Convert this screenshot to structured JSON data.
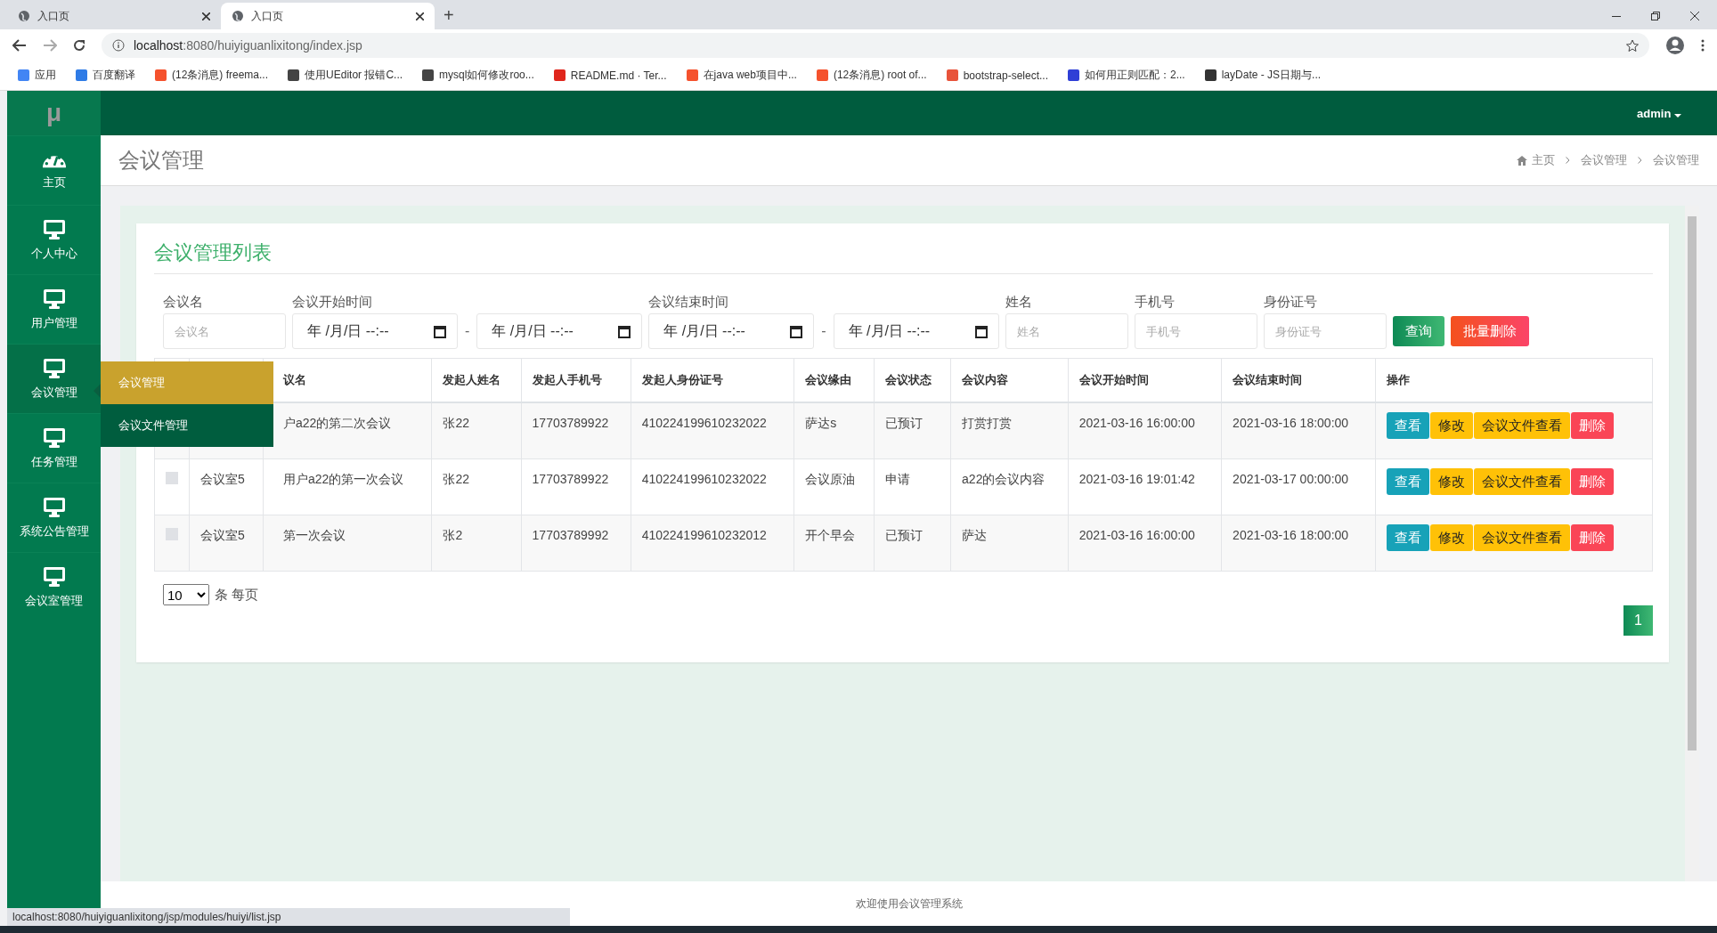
{
  "browser": {
    "tabs": [
      {
        "title": "入口页",
        "selected": false
      },
      {
        "title": "入口页",
        "selected": true
      }
    ],
    "new_tab": "+",
    "url_host": "localhost",
    "url_rest": ":8080/huiyiguanlixitong/index.jsp",
    "bookmarks": [
      {
        "label": "应用",
        "color": "#4285f4"
      },
      {
        "label": "百度翻译",
        "color": "#2e7be6"
      },
      {
        "label": "(12条消息) freema...",
        "color": "#f5522d"
      },
      {
        "label": "使用UEditor 报错C...",
        "color": "#444444"
      },
      {
        "label": "mysql如何修改roo...",
        "color": "#444444"
      },
      {
        "label": "README.md · Ter...",
        "color": "#e0261c"
      },
      {
        "label": "在java web项目中...",
        "color": "#f5522d"
      },
      {
        "label": "(12条消息) root of...",
        "color": "#f5522d"
      },
      {
        "label": "bootstrap-select...",
        "color": "#e8533a"
      },
      {
        "label": "如何用正则匹配：2...",
        "color": "#2f3fd6"
      },
      {
        "label": "layDate - JS日期与...",
        "color": "#333333"
      }
    ]
  },
  "app": {
    "brand": "μ",
    "user": "admin",
    "sidebar": [
      {
        "label": "主页",
        "kind": "gauge",
        "selected": false
      },
      {
        "label": "个人中心",
        "kind": "monitor",
        "selected": false
      },
      {
        "label": "用户管理",
        "kind": "monitor",
        "selected": false
      },
      {
        "label": "会议管理",
        "kind": "monitor",
        "selected": true
      },
      {
        "label": "任务管理",
        "kind": "monitor",
        "selected": false
      },
      {
        "label": "系统公告管理",
        "kind": "monitor",
        "selected": false
      },
      {
        "label": "会议室管理",
        "kind": "monitor",
        "selected": false
      }
    ],
    "submenu": [
      {
        "label": "会议管理",
        "selected": true
      },
      {
        "label": "会议文件管理",
        "selected": false
      }
    ],
    "page_title": "会议管理",
    "breadcrumb": [
      "主页",
      "会议管理",
      "会议管理"
    ],
    "card_title": "会议管理列表",
    "filters": [
      {
        "kind": "text",
        "label": "会议名",
        "placeholder": "会议名"
      },
      {
        "kind": "date-range",
        "label": "会议开始时间",
        "from": "年 /月/日 --:--",
        "separator": "-",
        "to": "年 /月/日 --:--"
      },
      {
        "kind": "date-range",
        "label": "会议结束时间",
        "from": "年 /月/日 --:--",
        "separator": "-",
        "to": "年 /月/日 --:--"
      },
      {
        "kind": "text",
        "label": "姓名",
        "placeholder": "姓名"
      },
      {
        "kind": "text",
        "label": "手机号",
        "placeholder": "手机号"
      },
      {
        "kind": "text",
        "label": "身份证号",
        "placeholder": "身份证号"
      }
    ],
    "search_button": "查询",
    "batch_delete_button": "批量删除",
    "columns": [
      "议名",
      "发起人姓名",
      "发起人手机号",
      "发起人身份证号",
      "会议缘由",
      "会议状态",
      "会议内容",
      "会议开始时间",
      "会议结束时间",
      "操作"
    ],
    "rows": [
      {
        "cells": [
          "户a22的第二次会议",
          "张22",
          "17703789922",
          "410224199610232022",
          "萨达s",
          "已预订",
          "打赏打赏",
          "2021-03-16 16:00:00",
          "2021-03-16 18:00:00"
        ],
        "actions": [
          {
            "label": "查看",
            "kind": "info"
          },
          {
            "label": "修改",
            "kind": "warn"
          },
          {
            "label": "会议文件查看",
            "kind": "warn"
          },
          {
            "label": "删除",
            "kind": "danger"
          }
        ]
      },
      {
        "checked": false,
        "room": "会议室5",
        "cells": [
          "用户a22的第一次会议",
          "张22",
          "17703789922",
          "410224199610232022",
          "会议原油",
          "申请",
          "a22的会议内容",
          "2021-03-16 19:01:42",
          "2021-03-17 00:00:00"
        ],
        "actions": [
          {
            "label": "查看",
            "kind": "info"
          },
          {
            "label": "修改",
            "kind": "warn"
          },
          {
            "label": "会议文件查看",
            "kind": "warn"
          },
          {
            "label": "删除",
            "kind": "danger"
          }
        ]
      },
      {
        "checked": false,
        "room": "会议室5",
        "cells": [
          "第一次会议",
          "张2",
          "17703789992",
          "410224199610232012",
          "开个早会",
          "已预订",
          "萨达",
          "2021-03-16 16:00:00",
          "2021-03-16 18:00:00"
        ],
        "actions": [
          {
            "label": "查看",
            "kind": "info"
          },
          {
            "label": "修改",
            "kind": "warn"
          },
          {
            "label": "会议文件查看",
            "kind": "warn"
          },
          {
            "label": "删除",
            "kind": "danger"
          }
        ]
      }
    ],
    "page_size": "10",
    "page_size_label": "条 每页",
    "pages": [
      {
        "label": "1",
        "selected": true
      }
    ],
    "footer": "欢迎使用会议管理系统",
    "status_url": "localhost:8080/huiyiguanlixitong/jsp/modules/huiyi/list.jsp"
  }
}
